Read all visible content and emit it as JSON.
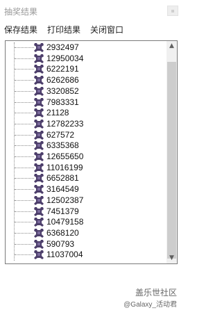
{
  "window": {
    "title": "抽奖结果"
  },
  "menu": {
    "save": "保存结果",
    "print": "打印结果",
    "close": "关闭窗口"
  },
  "icons": {
    "node": "purple-person-icon",
    "close": "close-icon"
  },
  "results": [
    "2932497",
    "12950034",
    "6222191",
    "6262686",
    "3320852",
    "7983331",
    "21128",
    "12782233",
    "627572",
    "6335368",
    "12655650",
    "11016199",
    "6652881",
    "3164549",
    "12502387",
    "7451379",
    "10479158",
    "6368120",
    "590793",
    "11037004"
  ],
  "watermark": {
    "line1": "盖乐世社区",
    "line2": "@Galaxy_活动君"
  }
}
